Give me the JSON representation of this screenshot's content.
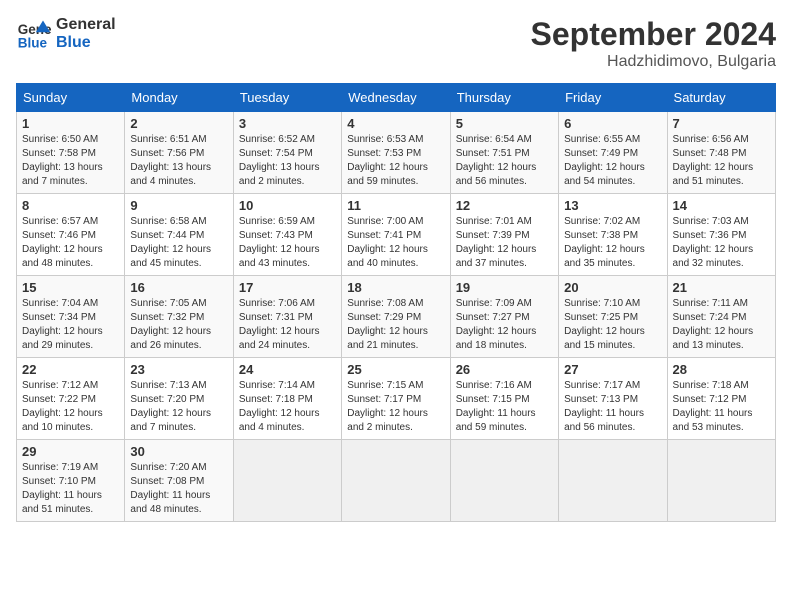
{
  "logo": {
    "line1": "General",
    "line2": "Blue"
  },
  "title": "September 2024",
  "location": "Hadzhidimovo, Bulgaria",
  "days_of_week": [
    "Sunday",
    "Monday",
    "Tuesday",
    "Wednesday",
    "Thursday",
    "Friday",
    "Saturday"
  ],
  "weeks": [
    [
      {
        "day": "1",
        "info": "Sunrise: 6:50 AM\nSunset: 7:58 PM\nDaylight: 13 hours\nand 7 minutes."
      },
      {
        "day": "2",
        "info": "Sunrise: 6:51 AM\nSunset: 7:56 PM\nDaylight: 13 hours\nand 4 minutes."
      },
      {
        "day": "3",
        "info": "Sunrise: 6:52 AM\nSunset: 7:54 PM\nDaylight: 13 hours\nand 2 minutes."
      },
      {
        "day": "4",
        "info": "Sunrise: 6:53 AM\nSunset: 7:53 PM\nDaylight: 12 hours\nand 59 minutes."
      },
      {
        "day": "5",
        "info": "Sunrise: 6:54 AM\nSunset: 7:51 PM\nDaylight: 12 hours\nand 56 minutes."
      },
      {
        "day": "6",
        "info": "Sunrise: 6:55 AM\nSunset: 7:49 PM\nDaylight: 12 hours\nand 54 minutes."
      },
      {
        "day": "7",
        "info": "Sunrise: 6:56 AM\nSunset: 7:48 PM\nDaylight: 12 hours\nand 51 minutes."
      }
    ],
    [
      {
        "day": "8",
        "info": "Sunrise: 6:57 AM\nSunset: 7:46 PM\nDaylight: 12 hours\nand 48 minutes."
      },
      {
        "day": "9",
        "info": "Sunrise: 6:58 AM\nSunset: 7:44 PM\nDaylight: 12 hours\nand 45 minutes."
      },
      {
        "day": "10",
        "info": "Sunrise: 6:59 AM\nSunset: 7:43 PM\nDaylight: 12 hours\nand 43 minutes."
      },
      {
        "day": "11",
        "info": "Sunrise: 7:00 AM\nSunset: 7:41 PM\nDaylight: 12 hours\nand 40 minutes."
      },
      {
        "day": "12",
        "info": "Sunrise: 7:01 AM\nSunset: 7:39 PM\nDaylight: 12 hours\nand 37 minutes."
      },
      {
        "day": "13",
        "info": "Sunrise: 7:02 AM\nSunset: 7:38 PM\nDaylight: 12 hours\nand 35 minutes."
      },
      {
        "day": "14",
        "info": "Sunrise: 7:03 AM\nSunset: 7:36 PM\nDaylight: 12 hours\nand 32 minutes."
      }
    ],
    [
      {
        "day": "15",
        "info": "Sunrise: 7:04 AM\nSunset: 7:34 PM\nDaylight: 12 hours\nand 29 minutes."
      },
      {
        "day": "16",
        "info": "Sunrise: 7:05 AM\nSunset: 7:32 PM\nDaylight: 12 hours\nand 26 minutes."
      },
      {
        "day": "17",
        "info": "Sunrise: 7:06 AM\nSunset: 7:31 PM\nDaylight: 12 hours\nand 24 minutes."
      },
      {
        "day": "18",
        "info": "Sunrise: 7:08 AM\nSunset: 7:29 PM\nDaylight: 12 hours\nand 21 minutes."
      },
      {
        "day": "19",
        "info": "Sunrise: 7:09 AM\nSunset: 7:27 PM\nDaylight: 12 hours\nand 18 minutes."
      },
      {
        "day": "20",
        "info": "Sunrise: 7:10 AM\nSunset: 7:25 PM\nDaylight: 12 hours\nand 15 minutes."
      },
      {
        "day": "21",
        "info": "Sunrise: 7:11 AM\nSunset: 7:24 PM\nDaylight: 12 hours\nand 13 minutes."
      }
    ],
    [
      {
        "day": "22",
        "info": "Sunrise: 7:12 AM\nSunset: 7:22 PM\nDaylight: 12 hours\nand 10 minutes."
      },
      {
        "day": "23",
        "info": "Sunrise: 7:13 AM\nSunset: 7:20 PM\nDaylight: 12 hours\nand 7 minutes."
      },
      {
        "day": "24",
        "info": "Sunrise: 7:14 AM\nSunset: 7:18 PM\nDaylight: 12 hours\nand 4 minutes."
      },
      {
        "day": "25",
        "info": "Sunrise: 7:15 AM\nSunset: 7:17 PM\nDaylight: 12 hours\nand 2 minutes."
      },
      {
        "day": "26",
        "info": "Sunrise: 7:16 AM\nSunset: 7:15 PM\nDaylight: 11 hours\nand 59 minutes."
      },
      {
        "day": "27",
        "info": "Sunrise: 7:17 AM\nSunset: 7:13 PM\nDaylight: 11 hours\nand 56 minutes."
      },
      {
        "day": "28",
        "info": "Sunrise: 7:18 AM\nSunset: 7:12 PM\nDaylight: 11 hours\nand 53 minutes."
      }
    ],
    [
      {
        "day": "29",
        "info": "Sunrise: 7:19 AM\nSunset: 7:10 PM\nDaylight: 11 hours\nand 51 minutes."
      },
      {
        "day": "30",
        "info": "Sunrise: 7:20 AM\nSunset: 7:08 PM\nDaylight: 11 hours\nand 48 minutes."
      },
      {
        "day": "",
        "info": ""
      },
      {
        "day": "",
        "info": ""
      },
      {
        "day": "",
        "info": ""
      },
      {
        "day": "",
        "info": ""
      },
      {
        "day": "",
        "info": ""
      }
    ]
  ]
}
